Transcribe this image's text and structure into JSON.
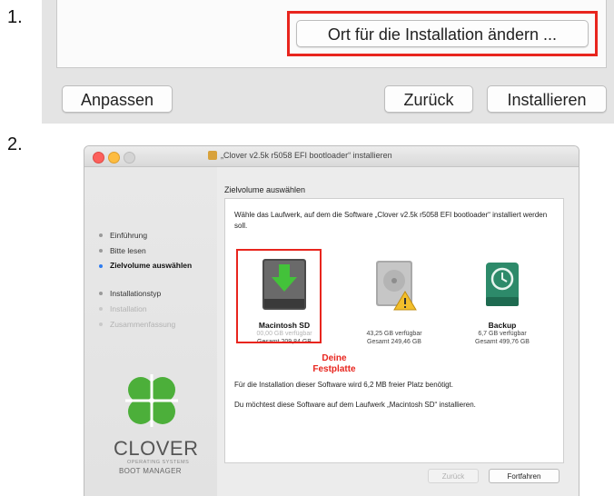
{
  "step1": {
    "number": "1.",
    "change_location_button": "Ort für die Installation ändern ...",
    "customize_button": "Anpassen",
    "back_button": "Zurück",
    "install_button": "Installieren"
  },
  "step2": {
    "number": "2.",
    "window_title": "„Clover v2.5k r5058 EFI bootloader“ installieren",
    "sidebar": {
      "items": [
        {
          "label": "Einführung",
          "state": "done"
        },
        {
          "label": "Bitte lesen",
          "state": "done"
        },
        {
          "label": "Zielvolume auswählen",
          "state": "active"
        },
        {
          "label": "Installationstyp",
          "state": "pending"
        },
        {
          "label": "Installation",
          "state": "disabled"
        },
        {
          "label": "Zusammenfassung",
          "state": "disabled"
        }
      ],
      "logo_text": "CLOVER",
      "logo_sub1": "OPERATING SYSTEMS",
      "logo_sub2": "BOOT MANAGER"
    },
    "content_title": "Zielvolume auswählen",
    "intro": "Wähle das Laufwerk, auf dem die Software „Clover v2.5k r5058 EFI bootloader“ installiert werden soll.",
    "drives": [
      {
        "name": "Macintosh SD",
        "available": "00,00 GB verfügbar",
        "total": "Gesamt 209,84 GB",
        "icon": "green-arrow-disk-icon"
      },
      {
        "name": "",
        "available": "43,25 GB verfügbar",
        "total": "Gesamt 249,46 GB",
        "icon": "warning-disk-icon"
      },
      {
        "name": "Backup",
        "available": "6,7 GB verfügbar",
        "total": "Gesamt 499,76 GB",
        "icon": "time-machine-disk-icon"
      }
    ],
    "annotation": {
      "line1": "Deine",
      "line2": "Festplatte"
    },
    "space_note": "Für die Installation dieser Software wird 6,2 MB freier Platz benötigt.",
    "confirm_text": "Du möchtest diese Software auf dem Laufwerk „Macintosh SD“ installieren.",
    "back_button": "Zurück",
    "continue_button": "Fortfahren"
  },
  "colors": {
    "highlight": "#e8251e",
    "active_dot": "#2e7cf0",
    "clover_green": "#4caf3a"
  }
}
